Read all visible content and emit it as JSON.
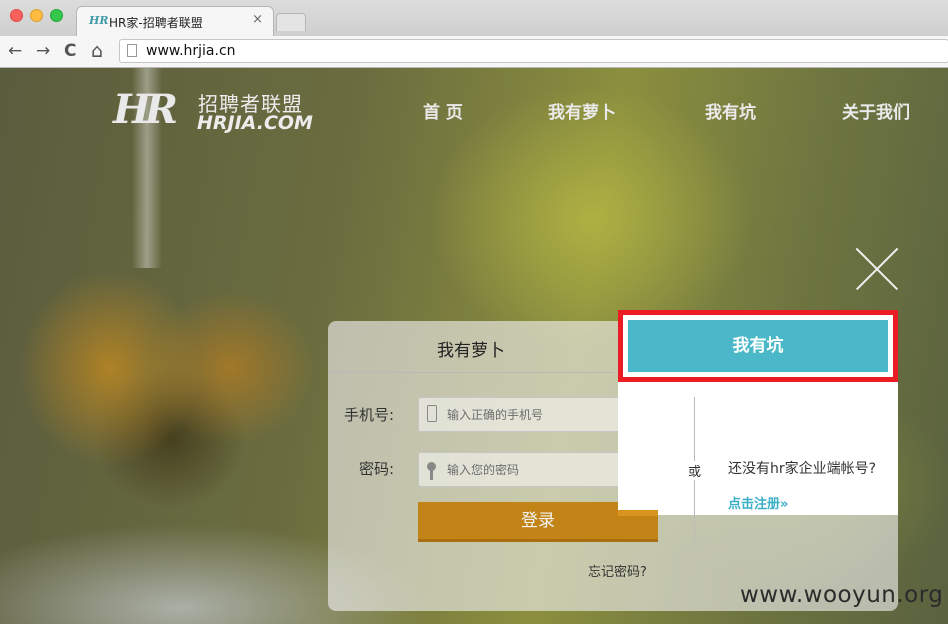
{
  "browser": {
    "tab_favicon": "HR",
    "tab_title": "HR家-招聘者联盟",
    "tab_close": "×",
    "url": "www.hrjia.cn",
    "back": "←",
    "forward": "→",
    "reload": "C",
    "home": "⌂"
  },
  "site": {
    "logo_mark": "HR",
    "logo_cn": "招聘者联盟",
    "logo_en": "HRJIA.COM",
    "nav": [
      "首 页",
      "我有萝卜",
      "我有坑",
      "关于我们"
    ]
  },
  "login": {
    "tab_left": "我有萝卜",
    "tab_right": "我有坑",
    "phone_label": "手机号:",
    "phone_placeholder": "输入正确的手机号",
    "password_label": "密码:",
    "password_placeholder": "输入您的密码",
    "login_button": "登录",
    "forgot": "忘记密码?",
    "or": "或",
    "register_question": "还没有hr家企业端帐号?",
    "register_link": "点击注册»"
  },
  "watermark": "www.wooyun.org",
  "colors": {
    "accent_teal": "#4ab8c8",
    "login_orange": "#c28417",
    "highlight_red": "#ec1c24"
  }
}
